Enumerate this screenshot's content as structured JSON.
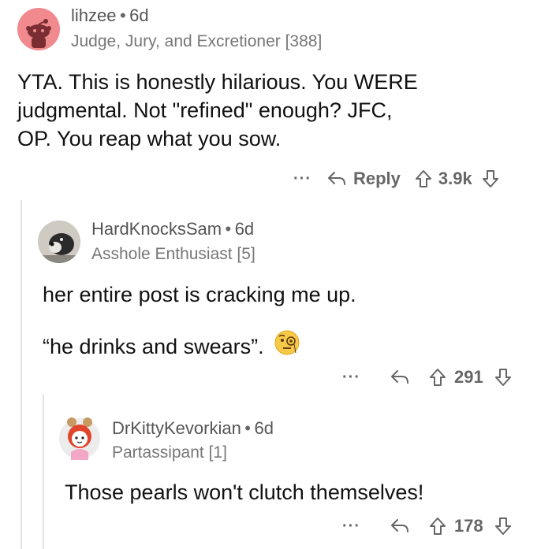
{
  "comments": [
    {
      "username": "lihzee",
      "age": "6d",
      "flair": "Judge, Jury, and Excretioner [388]",
      "body": [
        "YTA. This is honestly hilarious. You WERE",
        "judgmental. Not \"refined\" enough? JFC,",
        "OP. You reap what you sow."
      ],
      "more": "···",
      "reply_label": "Reply",
      "votes": "3.9k"
    },
    {
      "username": "HardKnocksSam",
      "age": "6d",
      "flair": "Asshole Enthusiast [5]",
      "body": [
        "her entire post is cracking me up.",
        "“he drinks and swears”."
      ],
      "more": "···",
      "votes": "291"
    },
    {
      "username": "DrKittyKevorkian",
      "age": "6d",
      "flair": "Partassipant [1]",
      "body": [
        "Those pearls won't clutch themselves!"
      ],
      "more": "···",
      "votes": "178"
    }
  ],
  "separator": "•",
  "colors": {
    "avatar1": "#f08a8f",
    "text": "#1c1c1c",
    "meta": "#666666"
  }
}
